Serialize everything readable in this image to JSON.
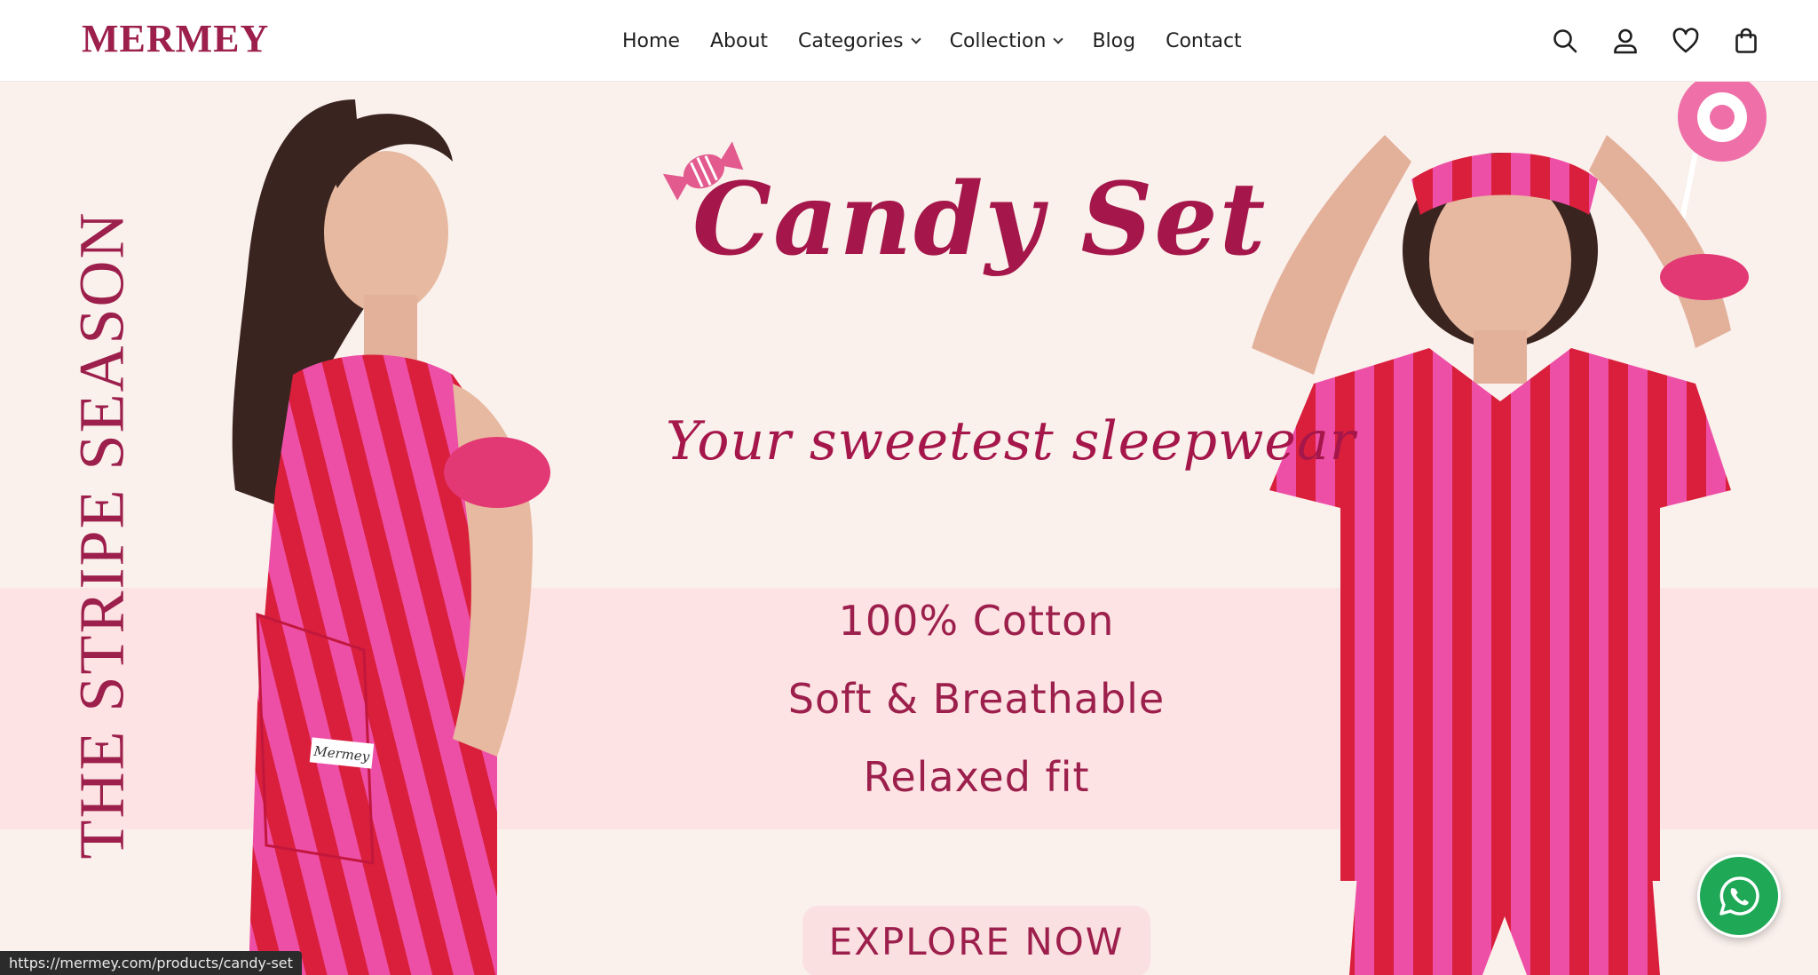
{
  "header": {
    "logo": "MERMEY",
    "nav": [
      {
        "label": "Home"
      },
      {
        "label": "About"
      },
      {
        "label": "Categories",
        "dropdown": true
      },
      {
        "label": "Collection",
        "dropdown": true
      },
      {
        "label": "Blog"
      },
      {
        "label": "Contact"
      }
    ],
    "icons": [
      "search-icon",
      "account-icon",
      "wishlist-heart-icon",
      "cart-bag-icon"
    ]
  },
  "hero": {
    "side_text": "THE STRIPE SEASON",
    "title": "Candy Set",
    "subtitle": "Your sweetest sleepwear",
    "features": [
      "100% Cotton",
      "Soft & Breathable",
      "Relaxed fit"
    ],
    "cta": "EXPLORE NOW",
    "label_tag": "Mermey"
  },
  "status_url": "https://mermey.com/products/candy-set",
  "colors": {
    "brand": "#9c1f4c",
    "hero_bg": "#faf0ec",
    "band_bg": "#fde3e3",
    "stripe_pink": "#ee4fa6",
    "stripe_red": "#d91f3c",
    "whatsapp": "#1fa855"
  }
}
